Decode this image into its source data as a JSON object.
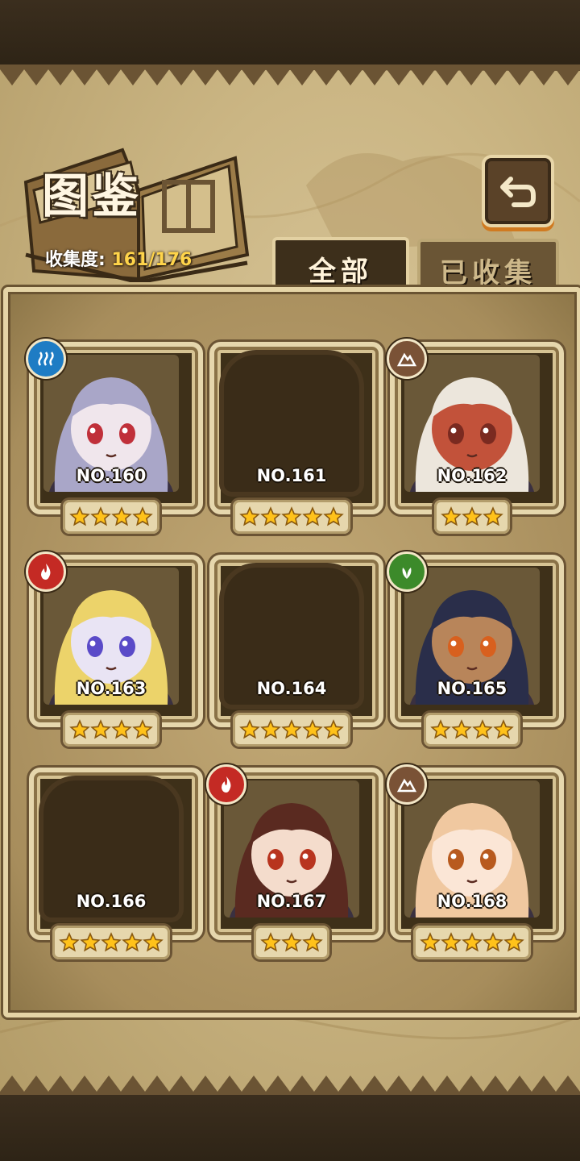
{
  "header": {
    "title": "图鉴",
    "collection_label": "收集度:",
    "collection_value": "161/176"
  },
  "tabs": [
    {
      "label": "全部",
      "active": true
    },
    {
      "label": "已收集",
      "active": false
    }
  ],
  "cards": [
    {
      "number": "NO.160",
      "stars": 4,
      "element": "water-icon",
      "collected": true,
      "hair": "#a9a6c8",
      "skin": "#f0e6ec",
      "eyes": "#c0303a"
    },
    {
      "number": "NO.161",
      "stars": 5,
      "element": "",
      "collected": false
    },
    {
      "number": "NO.162",
      "stars": 3,
      "element": "earth-icon",
      "collected": true,
      "hair": "#ece6dc",
      "skin": "#c2523a",
      "eyes": "#7a2a20"
    },
    {
      "number": "NO.163",
      "stars": 4,
      "element": "fire-icon",
      "collected": true,
      "hair": "#ecd36a",
      "skin": "#e9e4f4",
      "eyes": "#5a4ac8"
    },
    {
      "number": "NO.164",
      "stars": 5,
      "element": "",
      "collected": false
    },
    {
      "number": "NO.165",
      "stars": 4,
      "element": "wood-icon",
      "collected": true,
      "hair": "#2a2e4a",
      "skin": "#b8855a",
      "eyes": "#d8601e"
    },
    {
      "number": "NO.166",
      "stars": 5,
      "element": "",
      "collected": false
    },
    {
      "number": "NO.167",
      "stars": 3,
      "element": "fire-icon",
      "collected": true,
      "hair": "#5a2a20",
      "skin": "#f4dccc",
      "eyes": "#b8341e"
    },
    {
      "number": "NO.168",
      "stars": 5,
      "element": "earth-icon",
      "collected": true,
      "hair": "#f0c8a0",
      "skin": "#fbe6d6",
      "eyes": "#b85a1e"
    }
  ],
  "colors": {
    "star": "#ffc21a",
    "accent_orange": "#d07a20",
    "collection_value": "#ffd44a"
  }
}
